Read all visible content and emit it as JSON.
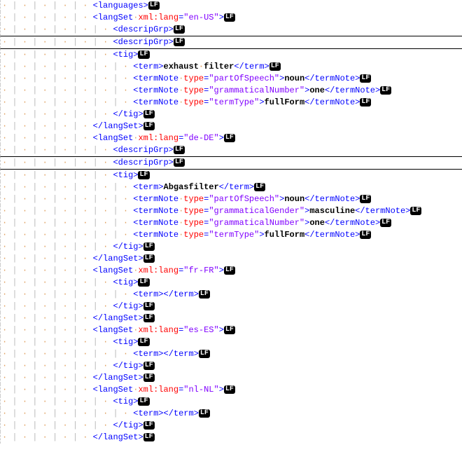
{
  "lf": "LF",
  "whitespace": {
    "dot": "·",
    "pipe": "|"
  },
  "lines": [
    {
      "indent": 4,
      "hr": false,
      "tokens": [
        {
          "t": "tag",
          "v": "<languages>"
        }
      ]
    },
    {
      "indent": 4,
      "hr": false,
      "tokens": [
        {
          "t": "tag",
          "v": "<langSet"
        },
        {
          "t": "ws",
          "v": " "
        },
        {
          "t": "attr",
          "v": "xml:lang"
        },
        {
          "t": "tag",
          "v": "="
        },
        {
          "t": "attrval",
          "v": "\"en-US\""
        },
        {
          "t": "tag",
          "v": ">"
        }
      ]
    },
    {
      "indent": 5,
      "hr": false,
      "tokens": [
        {
          "t": "tag",
          "v": "<descripGrp>"
        }
      ]
    },
    {
      "indent": 5,
      "hr": true,
      "tokens": [
        {
          "t": "tag",
          "v": "<descripGrp>"
        }
      ]
    },
    {
      "indent": 5,
      "hr": true,
      "tokens": [
        {
          "t": "tag",
          "v": "<tig>"
        }
      ]
    },
    {
      "indent": 6,
      "hr": false,
      "tokens": [
        {
          "t": "tag",
          "v": "<term>"
        },
        {
          "t": "text",
          "v": "exhaust filter"
        },
        {
          "t": "tag",
          "v": "</term>"
        }
      ]
    },
    {
      "indent": 6,
      "hr": false,
      "tokens": [
        {
          "t": "tag",
          "v": "<termNote"
        },
        {
          "t": "ws",
          "v": " "
        },
        {
          "t": "attr",
          "v": "type"
        },
        {
          "t": "tag",
          "v": "="
        },
        {
          "t": "attrval",
          "v": "\"partOfSpeech\""
        },
        {
          "t": "tag",
          "v": ">"
        },
        {
          "t": "text",
          "v": "noun"
        },
        {
          "t": "tag",
          "v": "</termNote>"
        }
      ]
    },
    {
      "indent": 6,
      "hr": false,
      "tokens": [
        {
          "t": "tag",
          "v": "<termNote"
        },
        {
          "t": "ws",
          "v": " "
        },
        {
          "t": "attr",
          "v": "type"
        },
        {
          "t": "tag",
          "v": "="
        },
        {
          "t": "attrval",
          "v": "\"grammaticalNumber\""
        },
        {
          "t": "tag",
          "v": ">"
        },
        {
          "t": "text",
          "v": "one"
        },
        {
          "t": "tag",
          "v": "</termNote>"
        }
      ]
    },
    {
      "indent": 6,
      "hr": false,
      "tokens": [
        {
          "t": "tag",
          "v": "<termNote"
        },
        {
          "t": "ws",
          "v": " "
        },
        {
          "t": "attr",
          "v": "type"
        },
        {
          "t": "tag",
          "v": "="
        },
        {
          "t": "attrval",
          "v": "\"termType\""
        },
        {
          "t": "tag",
          "v": ">"
        },
        {
          "t": "text",
          "v": "fullForm"
        },
        {
          "t": "tag",
          "v": "</termNote>"
        }
      ]
    },
    {
      "indent": 5,
      "hr": false,
      "tokens": [
        {
          "t": "tag",
          "v": "</tig>"
        }
      ]
    },
    {
      "indent": 4,
      "hr": false,
      "tokens": [
        {
          "t": "tag",
          "v": "</langSet>"
        }
      ]
    },
    {
      "indent": 4,
      "hr": false,
      "tokens": [
        {
          "t": "tag",
          "v": "<langSet"
        },
        {
          "t": "ws",
          "v": " "
        },
        {
          "t": "attr",
          "v": "xml:lang"
        },
        {
          "t": "tag",
          "v": "="
        },
        {
          "t": "attrval",
          "v": "\"de-DE\""
        },
        {
          "t": "tag",
          "v": ">"
        }
      ]
    },
    {
      "indent": 5,
      "hr": false,
      "tokens": [
        {
          "t": "tag",
          "v": "<descripGrp>"
        }
      ]
    },
    {
      "indent": 5,
      "hr": true,
      "tokens": [
        {
          "t": "tag",
          "v": "<descripGrp>"
        }
      ]
    },
    {
      "indent": 5,
      "hr": true,
      "tokens": [
        {
          "t": "tag",
          "v": "<tig>"
        }
      ]
    },
    {
      "indent": 6,
      "hr": false,
      "tokens": [
        {
          "t": "tag",
          "v": "<term>"
        },
        {
          "t": "text",
          "v": "Abgasfilter"
        },
        {
          "t": "tag",
          "v": "</term>"
        }
      ]
    },
    {
      "indent": 6,
      "hr": false,
      "tokens": [
        {
          "t": "tag",
          "v": "<termNote"
        },
        {
          "t": "ws",
          "v": " "
        },
        {
          "t": "attr",
          "v": "type"
        },
        {
          "t": "tag",
          "v": "="
        },
        {
          "t": "attrval",
          "v": "\"partOfSpeech\""
        },
        {
          "t": "tag",
          "v": ">"
        },
        {
          "t": "text",
          "v": "noun"
        },
        {
          "t": "tag",
          "v": "</termNote>"
        }
      ]
    },
    {
      "indent": 6,
      "hr": false,
      "tokens": [
        {
          "t": "tag",
          "v": "<termNote"
        },
        {
          "t": "ws",
          "v": " "
        },
        {
          "t": "attr",
          "v": "type"
        },
        {
          "t": "tag",
          "v": "="
        },
        {
          "t": "attrval",
          "v": "\"grammaticalGender\""
        },
        {
          "t": "tag",
          "v": ">"
        },
        {
          "t": "text",
          "v": "masculine"
        },
        {
          "t": "tag",
          "v": "</termNote>"
        }
      ]
    },
    {
      "indent": 6,
      "hr": false,
      "tokens": [
        {
          "t": "tag",
          "v": "<termNote"
        },
        {
          "t": "ws",
          "v": " "
        },
        {
          "t": "attr",
          "v": "type"
        },
        {
          "t": "tag",
          "v": "="
        },
        {
          "t": "attrval",
          "v": "\"grammaticalNumber\""
        },
        {
          "t": "tag",
          "v": ">"
        },
        {
          "t": "text",
          "v": "one"
        },
        {
          "t": "tag",
          "v": "</termNote>"
        }
      ]
    },
    {
      "indent": 6,
      "hr": false,
      "tokens": [
        {
          "t": "tag",
          "v": "<termNote"
        },
        {
          "t": "ws",
          "v": " "
        },
        {
          "t": "attr",
          "v": "type"
        },
        {
          "t": "tag",
          "v": "="
        },
        {
          "t": "attrval",
          "v": "\"termType\""
        },
        {
          "t": "tag",
          "v": ">"
        },
        {
          "t": "text",
          "v": "fullForm"
        },
        {
          "t": "tag",
          "v": "</termNote>"
        }
      ]
    },
    {
      "indent": 5,
      "hr": false,
      "tokens": [
        {
          "t": "tag",
          "v": "</tig>"
        }
      ]
    },
    {
      "indent": 4,
      "hr": false,
      "tokens": [
        {
          "t": "tag",
          "v": "</langSet>"
        }
      ]
    },
    {
      "indent": 4,
      "hr": false,
      "tokens": [
        {
          "t": "tag",
          "v": "<langSet"
        },
        {
          "t": "ws",
          "v": " "
        },
        {
          "t": "attr",
          "v": "xml:lang"
        },
        {
          "t": "tag",
          "v": "="
        },
        {
          "t": "attrval",
          "v": "\"fr-FR\""
        },
        {
          "t": "tag",
          "v": ">"
        }
      ]
    },
    {
      "indent": 5,
      "hr": false,
      "tokens": [
        {
          "t": "tag",
          "v": "<tig>"
        }
      ]
    },
    {
      "indent": 6,
      "hr": false,
      "tokens": [
        {
          "t": "tag",
          "v": "<term></term>"
        }
      ]
    },
    {
      "indent": 5,
      "hr": false,
      "tokens": [
        {
          "t": "tag",
          "v": "</tig>"
        }
      ]
    },
    {
      "indent": 4,
      "hr": false,
      "tokens": [
        {
          "t": "tag",
          "v": "</langSet>"
        }
      ]
    },
    {
      "indent": 4,
      "hr": false,
      "tokens": [
        {
          "t": "tag",
          "v": "<langSet"
        },
        {
          "t": "ws",
          "v": " "
        },
        {
          "t": "attr",
          "v": "xml:lang"
        },
        {
          "t": "tag",
          "v": "="
        },
        {
          "t": "attrval",
          "v": "\"es-ES\""
        },
        {
          "t": "tag",
          "v": ">"
        }
      ]
    },
    {
      "indent": 5,
      "hr": false,
      "tokens": [
        {
          "t": "tag",
          "v": "<tig>"
        }
      ]
    },
    {
      "indent": 6,
      "hr": false,
      "tokens": [
        {
          "t": "tag",
          "v": "<term></term>"
        }
      ]
    },
    {
      "indent": 5,
      "hr": false,
      "tokens": [
        {
          "t": "tag",
          "v": "</tig>"
        }
      ]
    },
    {
      "indent": 4,
      "hr": false,
      "tokens": [
        {
          "t": "tag",
          "v": "</langSet>"
        }
      ]
    },
    {
      "indent": 4,
      "hr": false,
      "tokens": [
        {
          "t": "tag",
          "v": "<langSet"
        },
        {
          "t": "ws",
          "v": " "
        },
        {
          "t": "attr",
          "v": "xml:lang"
        },
        {
          "t": "tag",
          "v": "="
        },
        {
          "t": "attrval",
          "v": "\"nl-NL\""
        },
        {
          "t": "tag",
          "v": ">"
        }
      ]
    },
    {
      "indent": 5,
      "hr": false,
      "tokens": [
        {
          "t": "tag",
          "v": "<tig>"
        }
      ]
    },
    {
      "indent": 6,
      "hr": false,
      "tokens": [
        {
          "t": "tag",
          "v": "<term></term>"
        }
      ]
    },
    {
      "indent": 5,
      "hr": false,
      "tokens": [
        {
          "t": "tag",
          "v": "</tig>"
        }
      ]
    },
    {
      "indent": 4,
      "hr": false,
      "tokens": [
        {
          "t": "tag",
          "v": "</langSet>"
        }
      ]
    }
  ]
}
